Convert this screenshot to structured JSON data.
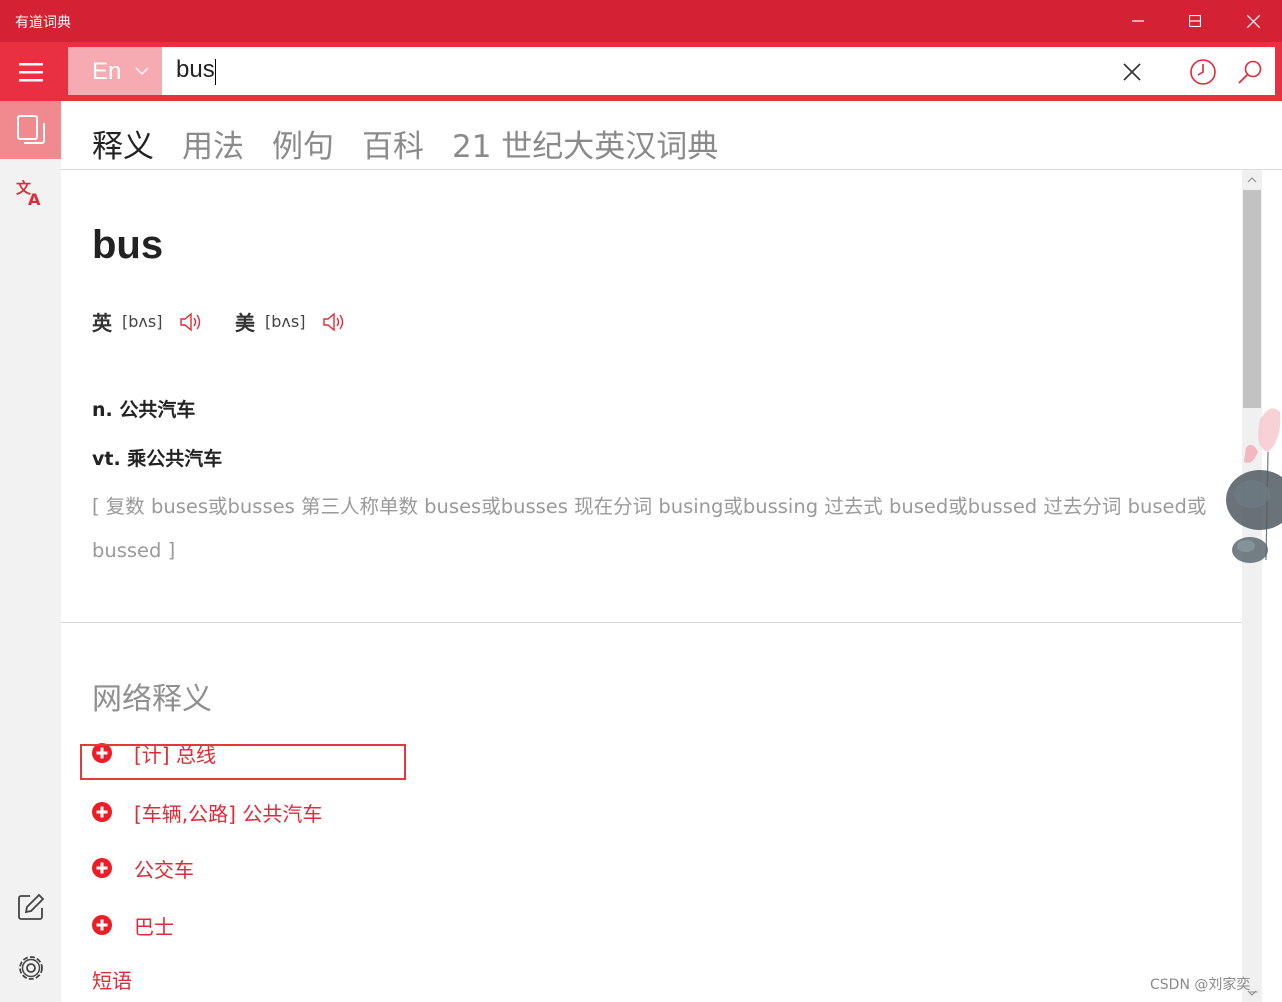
{
  "window": {
    "title": "有道词典"
  },
  "toolbar": {
    "language": "En",
    "search_value": "bus"
  },
  "tabs": [
    {
      "label": "释义",
      "active": true
    },
    {
      "label": "用法",
      "active": false
    },
    {
      "label": "例句",
      "active": false
    },
    {
      "label": "百科",
      "active": false
    },
    {
      "label": "21 世纪大英汉词典",
      "active": false
    }
  ],
  "entry": {
    "word": "bus",
    "pronunciations": [
      {
        "label": "英",
        "ipa": "[bʌs]"
      },
      {
        "label": "美",
        "ipa": "[bʌs]"
      }
    ],
    "definitions": [
      "n. 公共汽车",
      "vt. 乘公共汽车"
    ],
    "forms": "[ 复数 buses或busses 第三人称单数 buses或busses 现在分词 busing或bussing 过去式 bused或bussed 过去分词 bused或bussed ]"
  },
  "web_definitions": {
    "title": "网络释义",
    "items": [
      "[计] 总线",
      "[车辆,公路] 公共汽车",
      "公交车",
      "巴士"
    ],
    "phrases_label": "短语"
  },
  "watermark": "CSDN @刘家奕_",
  "colors": {
    "title_bar": "#d42134",
    "toolbar": "#e83040",
    "accent": "#e02a38",
    "rail_active": "#f08a8f"
  },
  "icons": {
    "menu": "hamburger-icon",
    "clear": "close-icon",
    "history": "clock-icon",
    "search": "search-icon",
    "dictionary": "copy-pages-icon",
    "translate": "translate-icon",
    "notes": "edit-icon",
    "settings": "gear-icon",
    "speaker": "speaker-icon",
    "expand": "plus-circle-icon"
  }
}
